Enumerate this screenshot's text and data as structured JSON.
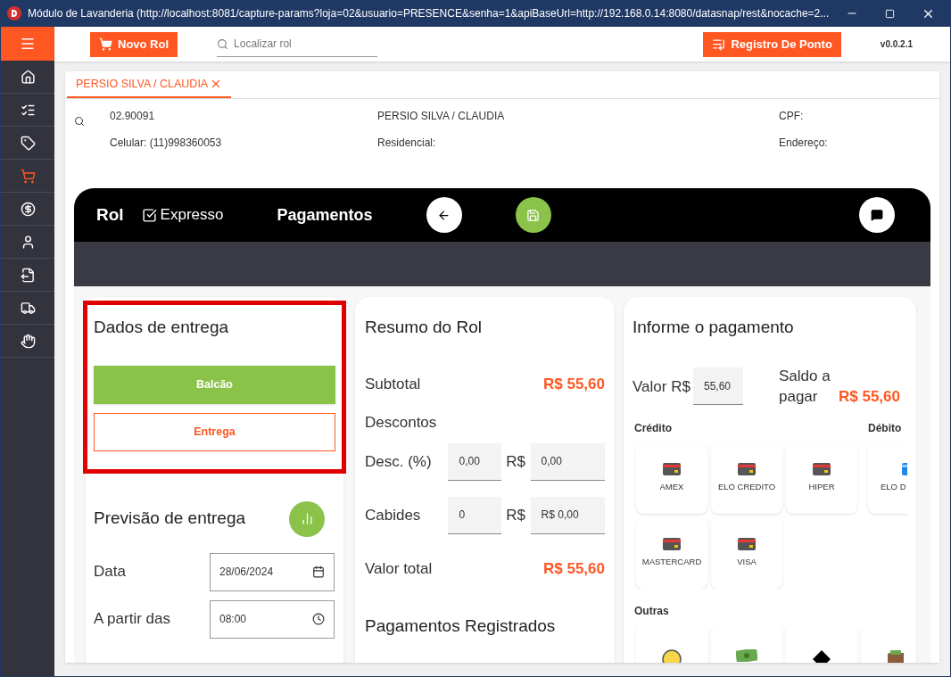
{
  "window": {
    "title": "Módulo de Lavanderia (http://localhost:8081/capture-params?loja=02&usuario=PRESENCE&senha=1&apiBaseUrl=http://192.168.0.14:8080/datasnap/rest&nocache=2..."
  },
  "sidebar": {
    "items": [
      {
        "kind": "home",
        "selected": false
      },
      {
        "kind": "checklist",
        "selected": false
      },
      {
        "kind": "tag",
        "selected": false
      },
      {
        "kind": "cart",
        "selected": true
      },
      {
        "kind": "dollar",
        "selected": false
      },
      {
        "kind": "user",
        "selected": false
      },
      {
        "kind": "export",
        "selected": false
      },
      {
        "kind": "truck",
        "selected": false
      },
      {
        "kind": "hand",
        "selected": false
      }
    ]
  },
  "toolbar": {
    "new_button": "Novo Rol",
    "search": {
      "placeholder": "Localizar rol"
    },
    "punch_button": "Registro De Ponto",
    "version": "v0.0.2.1"
  },
  "tabs": [
    {
      "label": "PERSIO SILVA / CLAUDIA",
      "selected": true
    }
  ],
  "customer": {
    "code": "02.90091",
    "name": "PERSIO SILVA / CLAUDIA",
    "cpf": "CPF:",
    "phone": "Celular: (11)998360053",
    "residential": "Residencial:",
    "address": "Endereço:"
  },
  "rol_header": {
    "title": "Rol",
    "express": {
      "label": "Expresso",
      "checked": true
    },
    "section": "Pagamentos"
  },
  "delivery": {
    "title": "Dados de entrega",
    "options": [
      {
        "label": "Balcão",
        "selected": true
      },
      {
        "label": "Entrega",
        "selected": false
      }
    ]
  },
  "forecast": {
    "title": "Previsão de entrega",
    "fields": [
      {
        "label": "Data",
        "value": "28/06/2024",
        "kind": "date"
      },
      {
        "label": "A partir das",
        "value": "08:00",
        "kind": "time"
      }
    ]
  },
  "summary": {
    "title": "Resumo do Rol",
    "subtotal_label": "Subtotal",
    "subtotal": "R$ 55,60",
    "discounts_label": "Descontos",
    "rows": [
      {
        "label": "Desc. (%)",
        "input": "0,00",
        "currency": "R$",
        "amount": "0,00"
      },
      {
        "label": "Cabides",
        "input": "0",
        "currency": "R$",
        "amount": "R$ 0,00"
      }
    ],
    "total_label": "Valor total",
    "total": "R$ 55,60",
    "registered_title": "Pagamentos Registrados"
  },
  "payment": {
    "title": "Informe o pagamento",
    "value_label": "Valor R$",
    "value": "55,60",
    "balance_label": "Saldo a pagar",
    "balance": "R$ 55,60",
    "credit_label": "Crédito",
    "credit_cards": [
      {
        "label": "AMEX"
      },
      {
        "label": "ELO CREDITO"
      },
      {
        "label": "HIPER"
      },
      {
        "label": "MASTERCARD"
      },
      {
        "label": "VISA"
      }
    ],
    "debit_label": "Débito",
    "debit_cards": [
      {
        "label": "ELO D"
      }
    ],
    "other_label": "Outras",
    "other_methods": [
      {
        "kind": "coin"
      },
      {
        "kind": "cash"
      },
      {
        "kind": "diamond"
      },
      {
        "kind": "wallet"
      }
    ]
  }
}
